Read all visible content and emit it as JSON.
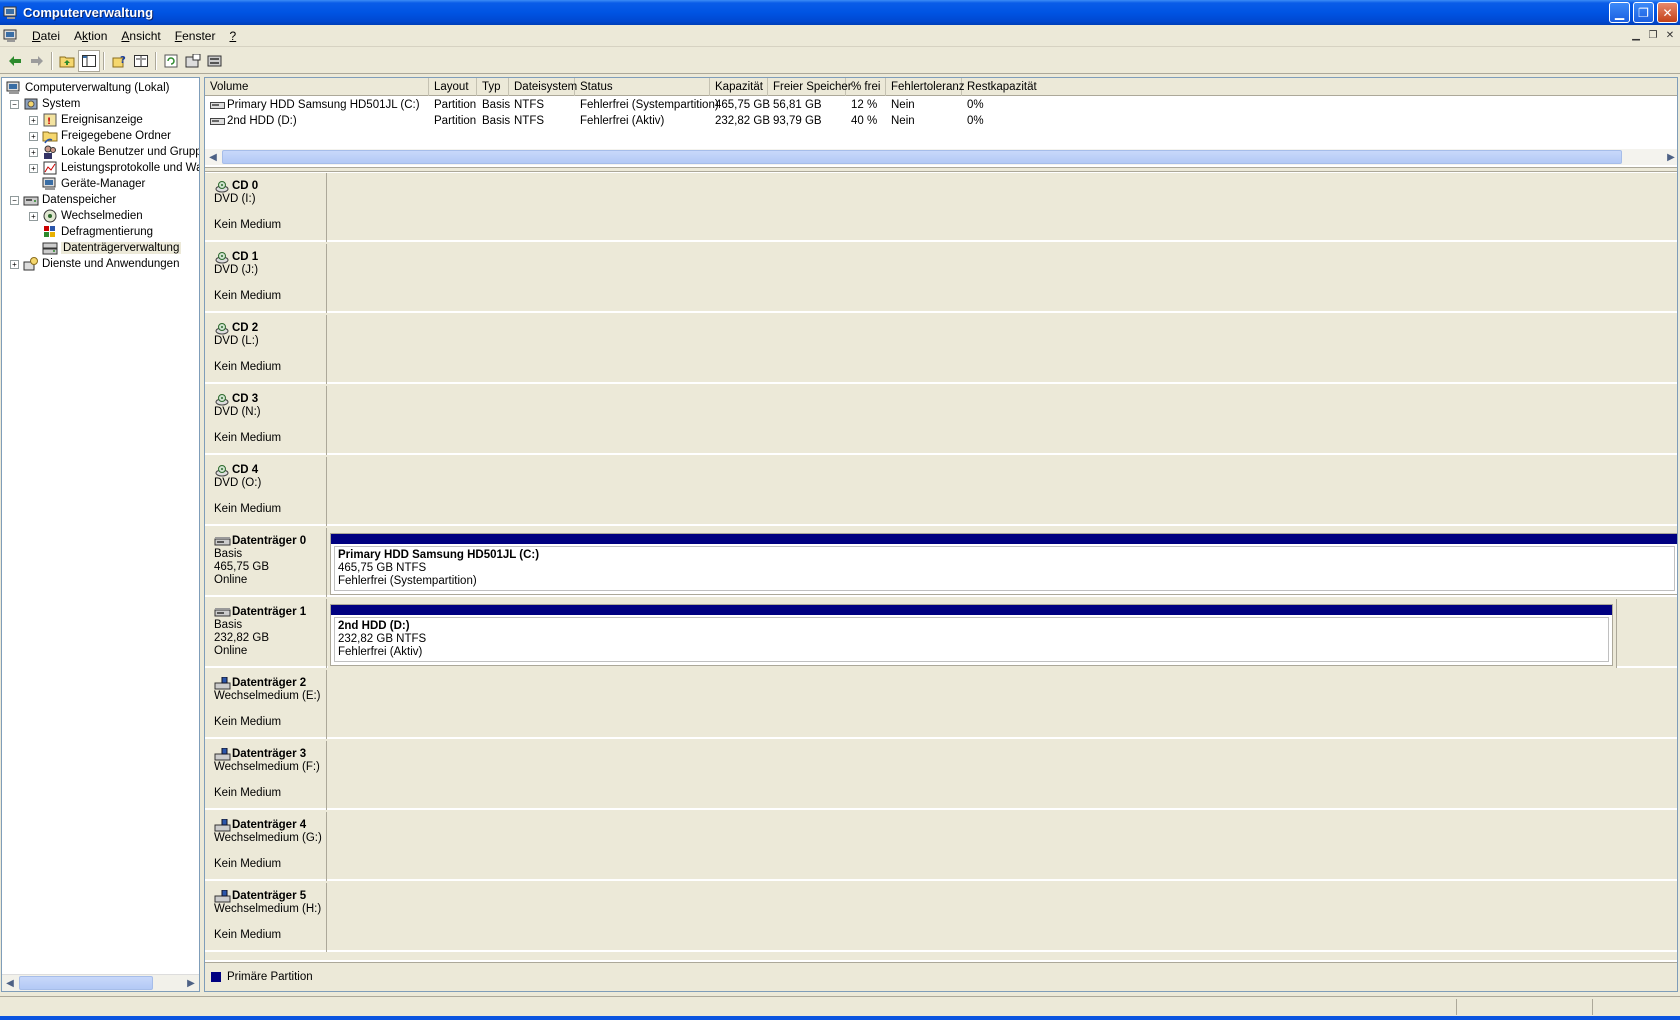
{
  "window": {
    "title": "Computerverwaltung"
  },
  "menu": [
    {
      "pre": "",
      "u": "D",
      "post": "atei"
    },
    {
      "pre": "A",
      "u": "k",
      "post": "tion"
    },
    {
      "pre": "",
      "u": "A",
      "post": "nsicht"
    },
    {
      "pre": "",
      "u": "F",
      "post": "enster"
    },
    {
      "pre": "",
      "u": "?",
      "post": ""
    }
  ],
  "tree": {
    "root": "Computerverwaltung (Lokal)",
    "system": "System",
    "ereignis": "Ereignisanzeige",
    "freigegeben": "Freigegebene Ordner",
    "benutzer": "Lokale Benutzer und Gruppe",
    "leistung": "Leistungsprotokolle und War",
    "geraete": "Geräte-Manager",
    "datenspeicher": "Datenspeicher",
    "wechsel": "Wechselmedien",
    "defrag": "Defragmentierung",
    "dtv": "Datenträgerverwaltung",
    "dienste": "Dienste und Anwendungen"
  },
  "volume_columns": [
    "Volume",
    "Layout",
    "Typ",
    "Dateisystem",
    "Status",
    "Kapazität",
    "Freier Speicher",
    "% frei",
    "Fehlertoleranz",
    "Restkapazität"
  ],
  "volumes": [
    [
      "Primary HDD Samsung HD501JL (C:)",
      "Partition",
      "Basis",
      "NTFS",
      "Fehlerfrei (Systempartition)",
      "465,75 GB",
      "56,81 GB",
      "12 %",
      "Nein",
      "0%"
    ],
    [
      "2nd HDD (D:)",
      "Partition",
      "Basis",
      "NTFS",
      "Fehlerfrei (Aktiv)",
      "232,82 GB",
      "93,79 GB",
      "40 %",
      "Nein",
      "0%"
    ]
  ],
  "disks": [
    {
      "name": "CD 0",
      "line1": "DVD (I:)",
      "line2": "",
      "line3": "Kein Medium",
      "icon": "cdrom-icon"
    },
    {
      "name": "CD 1",
      "line1": "DVD (J:)",
      "line2": "",
      "line3": "Kein Medium",
      "icon": "cdrom-icon"
    },
    {
      "name": "CD 2",
      "line1": "DVD (L:)",
      "line2": "",
      "line3": "Kein Medium",
      "icon": "cdrom-icon"
    },
    {
      "name": "CD 3",
      "line1": "DVD (N:)",
      "line2": "",
      "line3": "Kein Medium",
      "icon": "cdrom-icon"
    },
    {
      "name": "CD 4",
      "line1": "DVD (O:)",
      "line2": "",
      "line3": "Kein Medium",
      "icon": "cdrom-icon"
    },
    {
      "name": "Datenträger 0",
      "line1": "Basis",
      "line2": "465,75 GB",
      "line3": "Online",
      "icon": "harddisk-icon",
      "partition": {
        "title": "Primary HDD Samsung HD501JL  (C:)",
        "size": "465,75 GB NTFS",
        "status": "Fehlerfrei (Systempartition)"
      }
    },
    {
      "name": "Datenträger 1",
      "line1": "Basis",
      "line2": "232,82 GB",
      "line3": "Online",
      "icon": "harddisk-icon",
      "partition": {
        "title": "2nd HDD  (D:)",
        "size": "232,82 GB NTFS",
        "status": "Fehlerfrei (Aktiv)"
      }
    },
    {
      "name": "Datenträger 2",
      "line1": "Wechselmedium (E:)",
      "line2": "",
      "line3": "Kein Medium",
      "icon": "removable-disk-icon"
    },
    {
      "name": "Datenträger 3",
      "line1": "Wechselmedium (F:)",
      "line2": "",
      "line3": "Kein Medium",
      "icon": "removable-disk-icon"
    },
    {
      "name": "Datenträger 4",
      "line1": "Wechselmedium (G:)",
      "line2": "",
      "line3": "Kein Medium",
      "icon": "removable-disk-icon"
    },
    {
      "name": "Datenträger 5",
      "line1": "Wechselmedium (H:)",
      "line2": "",
      "line3": "Kein Medium",
      "icon": "removable-disk-icon"
    }
  ],
  "legend": {
    "label": "Primäre Partition",
    "color": "#000080"
  },
  "colors": {
    "titlebar": "#0054e3",
    "partition_bar": "#000080",
    "face": "#ece9d8"
  }
}
